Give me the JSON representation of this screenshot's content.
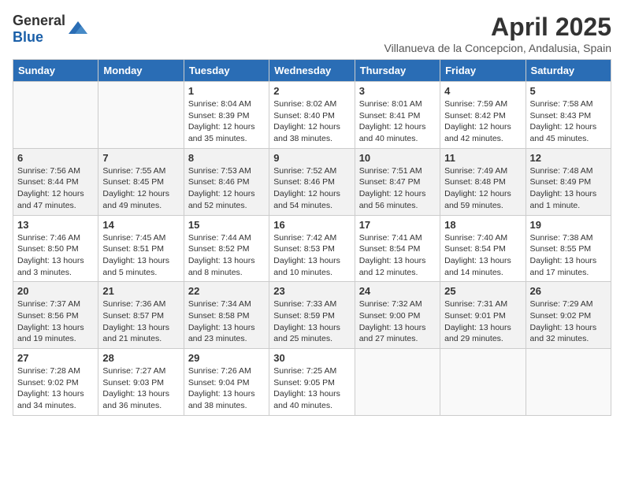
{
  "logo": {
    "text_general": "General",
    "text_blue": "Blue"
  },
  "title": "April 2025",
  "subtitle": "Villanueva de la Concepcion, Andalusia, Spain",
  "weekdays": [
    "Sunday",
    "Monday",
    "Tuesday",
    "Wednesday",
    "Thursday",
    "Friday",
    "Saturday"
  ],
  "weeks": [
    [
      {
        "day": "",
        "info": ""
      },
      {
        "day": "",
        "info": ""
      },
      {
        "day": "1",
        "info": "Sunrise: 8:04 AM\nSunset: 8:39 PM\nDaylight: 12 hours and 35 minutes."
      },
      {
        "day": "2",
        "info": "Sunrise: 8:02 AM\nSunset: 8:40 PM\nDaylight: 12 hours and 38 minutes."
      },
      {
        "day": "3",
        "info": "Sunrise: 8:01 AM\nSunset: 8:41 PM\nDaylight: 12 hours and 40 minutes."
      },
      {
        "day": "4",
        "info": "Sunrise: 7:59 AM\nSunset: 8:42 PM\nDaylight: 12 hours and 42 minutes."
      },
      {
        "day": "5",
        "info": "Sunrise: 7:58 AM\nSunset: 8:43 PM\nDaylight: 12 hours and 45 minutes."
      }
    ],
    [
      {
        "day": "6",
        "info": "Sunrise: 7:56 AM\nSunset: 8:44 PM\nDaylight: 12 hours and 47 minutes."
      },
      {
        "day": "7",
        "info": "Sunrise: 7:55 AM\nSunset: 8:45 PM\nDaylight: 12 hours and 49 minutes."
      },
      {
        "day": "8",
        "info": "Sunrise: 7:53 AM\nSunset: 8:46 PM\nDaylight: 12 hours and 52 minutes."
      },
      {
        "day": "9",
        "info": "Sunrise: 7:52 AM\nSunset: 8:46 PM\nDaylight: 12 hours and 54 minutes."
      },
      {
        "day": "10",
        "info": "Sunrise: 7:51 AM\nSunset: 8:47 PM\nDaylight: 12 hours and 56 minutes."
      },
      {
        "day": "11",
        "info": "Sunrise: 7:49 AM\nSunset: 8:48 PM\nDaylight: 12 hours and 59 minutes."
      },
      {
        "day": "12",
        "info": "Sunrise: 7:48 AM\nSunset: 8:49 PM\nDaylight: 13 hours and 1 minute."
      }
    ],
    [
      {
        "day": "13",
        "info": "Sunrise: 7:46 AM\nSunset: 8:50 PM\nDaylight: 13 hours and 3 minutes."
      },
      {
        "day": "14",
        "info": "Sunrise: 7:45 AM\nSunset: 8:51 PM\nDaylight: 13 hours and 5 minutes."
      },
      {
        "day": "15",
        "info": "Sunrise: 7:44 AM\nSunset: 8:52 PM\nDaylight: 13 hours and 8 minutes."
      },
      {
        "day": "16",
        "info": "Sunrise: 7:42 AM\nSunset: 8:53 PM\nDaylight: 13 hours and 10 minutes."
      },
      {
        "day": "17",
        "info": "Sunrise: 7:41 AM\nSunset: 8:54 PM\nDaylight: 13 hours and 12 minutes."
      },
      {
        "day": "18",
        "info": "Sunrise: 7:40 AM\nSunset: 8:54 PM\nDaylight: 13 hours and 14 minutes."
      },
      {
        "day": "19",
        "info": "Sunrise: 7:38 AM\nSunset: 8:55 PM\nDaylight: 13 hours and 17 minutes."
      }
    ],
    [
      {
        "day": "20",
        "info": "Sunrise: 7:37 AM\nSunset: 8:56 PM\nDaylight: 13 hours and 19 minutes."
      },
      {
        "day": "21",
        "info": "Sunrise: 7:36 AM\nSunset: 8:57 PM\nDaylight: 13 hours and 21 minutes."
      },
      {
        "day": "22",
        "info": "Sunrise: 7:34 AM\nSunset: 8:58 PM\nDaylight: 13 hours and 23 minutes."
      },
      {
        "day": "23",
        "info": "Sunrise: 7:33 AM\nSunset: 8:59 PM\nDaylight: 13 hours and 25 minutes."
      },
      {
        "day": "24",
        "info": "Sunrise: 7:32 AM\nSunset: 9:00 PM\nDaylight: 13 hours and 27 minutes."
      },
      {
        "day": "25",
        "info": "Sunrise: 7:31 AM\nSunset: 9:01 PM\nDaylight: 13 hours and 29 minutes."
      },
      {
        "day": "26",
        "info": "Sunrise: 7:29 AM\nSunset: 9:02 PM\nDaylight: 13 hours and 32 minutes."
      }
    ],
    [
      {
        "day": "27",
        "info": "Sunrise: 7:28 AM\nSunset: 9:02 PM\nDaylight: 13 hours and 34 minutes."
      },
      {
        "day": "28",
        "info": "Sunrise: 7:27 AM\nSunset: 9:03 PM\nDaylight: 13 hours and 36 minutes."
      },
      {
        "day": "29",
        "info": "Sunrise: 7:26 AM\nSunset: 9:04 PM\nDaylight: 13 hours and 38 minutes."
      },
      {
        "day": "30",
        "info": "Sunrise: 7:25 AM\nSunset: 9:05 PM\nDaylight: 13 hours and 40 minutes."
      },
      {
        "day": "",
        "info": ""
      },
      {
        "day": "",
        "info": ""
      },
      {
        "day": "",
        "info": ""
      }
    ]
  ]
}
